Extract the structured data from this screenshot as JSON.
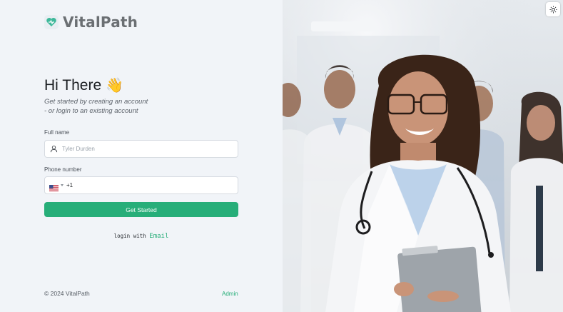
{
  "brand": {
    "name": "VitalPath"
  },
  "hero": {
    "title": "Hi There",
    "wave_emoji": "👋",
    "subtitle_line1": "Get started by creating an account",
    "subtitle_line2": "- or login to an existing account"
  },
  "form": {
    "full_name_label": "Full name",
    "full_name_placeholder": "Tyler Durden",
    "phone_label": "Phone number",
    "phone_country_code": "+1",
    "submit_label": "Get Started"
  },
  "alt_login": {
    "prefix": "login with",
    "link": "Email"
  },
  "footer": {
    "copyright": "© 2024 VitalPath",
    "admin_link": "Admin"
  },
  "colors": {
    "accent": "#27ae79",
    "background": "#f1f4f8"
  },
  "icons": {
    "theme_toggle": "sun-icon",
    "user": "user-icon",
    "flag": "us-flag-icon"
  }
}
